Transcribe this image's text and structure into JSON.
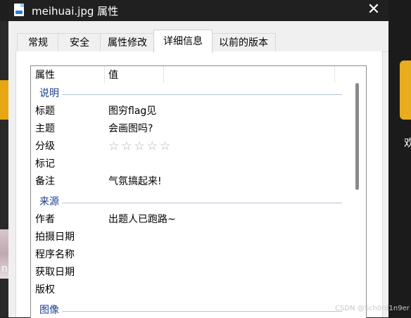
{
  "window": {
    "title": "meihuai.jpg 属性",
    "close_glyph": "✕"
  },
  "tabs": [
    {
      "label": "常规"
    },
    {
      "label": "安全"
    },
    {
      "label": "属性修改"
    },
    {
      "label": "详细信息"
    },
    {
      "label": "以前的版本"
    }
  ],
  "active_tab": "详细信息",
  "list": {
    "header": {
      "property": "属性",
      "value": "值"
    },
    "groups": [
      {
        "name": "说明",
        "rows": [
          {
            "label": "标题",
            "value": "图穷flag见"
          },
          {
            "label": "主题",
            "value": "会画图吗?"
          },
          {
            "label": "分级",
            "value": "",
            "rating": 0,
            "rating_max": 5,
            "star_glyph": "☆"
          },
          {
            "label": "标记",
            "value": ""
          },
          {
            "label": "备注",
            "value": "气氛搞起来!"
          }
        ]
      },
      {
        "name": "来源",
        "rows": [
          {
            "label": "作者",
            "value": "出题人已跑路~"
          },
          {
            "label": "拍摄日期",
            "value": ""
          },
          {
            "label": "程序名称",
            "value": ""
          },
          {
            "label": "获取日期",
            "value": ""
          },
          {
            "label": "版权",
            "value": ""
          }
        ]
      },
      {
        "name": "图像",
        "rows": []
      }
    ]
  },
  "desktop": {
    "left_glyph": "n",
    "right_glyph": "欢"
  },
  "watermark": "CSDN @Sch0rd1n9er",
  "colors": {
    "titlebar": "#202020",
    "group_header": "#1a3d8f",
    "window": "#f0f0f0",
    "panel": "#ffffff"
  },
  "icons": {
    "app": "image-file-icon",
    "close": "close-icon",
    "rating": "star-outline-icon"
  }
}
